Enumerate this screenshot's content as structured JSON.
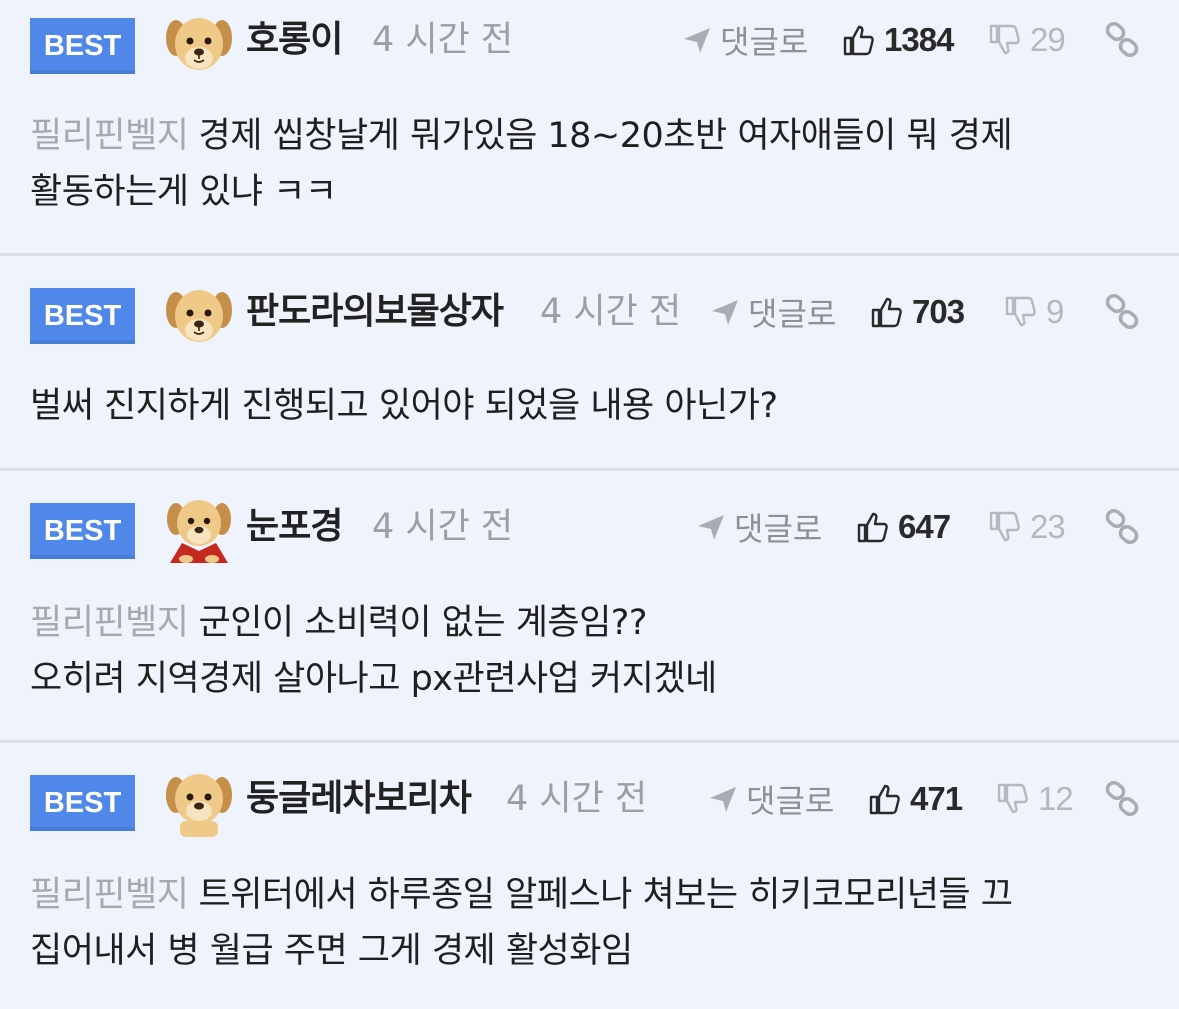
{
  "comments": [
    {
      "badge": "BEST",
      "nickname": "호롱이",
      "time": "4 시간 전",
      "reply_label": "댓글로",
      "likes": "1384",
      "dislikes": "29",
      "source": "필리핀벨지",
      "text_line1": "경제 씹창날게 뭐가있음 18~20초반 여자애들이 뭐 경제",
      "text_line2": "활동하는게 있냐 ㅋㅋ"
    },
    {
      "badge": "BEST",
      "nickname": "판도라의보물상자",
      "time": "4 시간 전",
      "reply_label": "댓글로",
      "likes": "703",
      "dislikes": "9",
      "text_line1": "벌써 진지하게 진행되고 있어야 되었을 내용 아닌가?"
    },
    {
      "badge": "BEST",
      "nickname": "눈포경",
      "time": "4 시간 전",
      "reply_label": "댓글로",
      "likes": "647",
      "dislikes": "23",
      "source": "필리핀벨지",
      "text_line1": "군인이 소비력이 없는 계층임??",
      "text_line2": "오히려 지역경제 살아나고 px관련사업 커지겠네"
    },
    {
      "badge": "BEST",
      "nickname": "둥글레차보리차",
      "time": "4 시간 전",
      "reply_label": "댓글로",
      "likes": "471",
      "dislikes": "12",
      "source": "필리핀벨지",
      "text_line1": "트위터에서 하루종일 알페스나 쳐보는 히키코모리년들 끄",
      "text_line2": "집어내서 병 월급 주면 그게 경제 활성화임"
    }
  ],
  "icons": {
    "reply": "reply-arrow-icon",
    "like": "thumbs-up-icon",
    "dislike": "thumbs-down-icon",
    "link": "link-icon",
    "avatar": "puppy-avatar-icon"
  },
  "colors": {
    "badge": "#4f88e8",
    "background": "#eff3fb",
    "muted": "#9a9ea6"
  }
}
